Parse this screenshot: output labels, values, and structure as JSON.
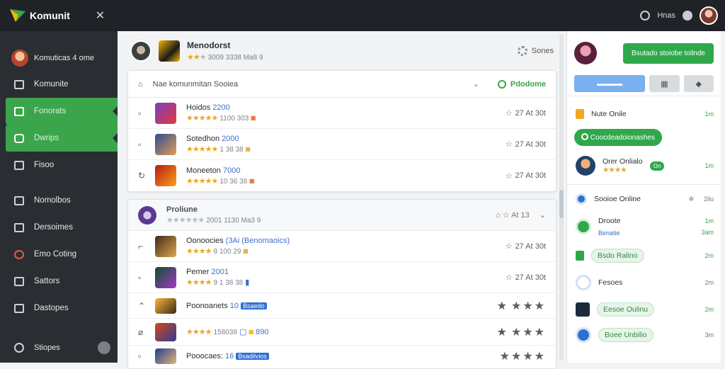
{
  "topbar": {
    "brand": "Komunit",
    "close_icon": "close-icon",
    "right_label": "Hnas"
  },
  "sidebar": {
    "user": "Komuticas 4 ome",
    "items": [
      {
        "label": "Komunite",
        "icon": "panel-icon"
      },
      {
        "label": "Fonorats",
        "icon": "flag-icon",
        "active": true
      },
      {
        "label": "Dwrips",
        "icon": "shield-icon",
        "active": true
      },
      {
        "label": "Fisoo",
        "icon": "grid-icon"
      },
      {
        "label": "Nomolbos",
        "icon": "users-icon"
      },
      {
        "label": "Dersoimes",
        "icon": "list-icon"
      },
      {
        "label": "Emo Coting",
        "icon": "target-icon"
      },
      {
        "label": "Sattors",
        "icon": "sliders-icon"
      },
      {
        "label": "Dastopes",
        "icon": "chat-icon"
      }
    ],
    "footer": "Stiopes"
  },
  "main": {
    "header": {
      "title": "Menodorst",
      "meta": "3009 3338 Ma8 9",
      "right": "Sones"
    },
    "card1": {
      "header": "Nae komunmitan Sooiea",
      "badge": "Pdodome",
      "rows": [
        {
          "name": "Hoidos",
          "num": "2200",
          "meta": "1100 303",
          "right": "27 At 30t"
        },
        {
          "name": "Sotedhon",
          "num": "2000",
          "meta": "1 38 38",
          "right": "27 At 30t"
        },
        {
          "name": "Moneeton",
          "num": "7000",
          "meta": "10 36 38",
          "right": "27 At 30t"
        }
      ]
    },
    "card2": {
      "header": "Proliune",
      "meta": "2001 1130 Ma3 9",
      "header_right": "At 13",
      "rows": [
        {
          "name": "Oonoocies",
          "num": "(3Ai (Benomaoics)",
          "meta": "9 100 29",
          "right": "27 At 30t"
        },
        {
          "name": "Pemer",
          "num": "2001",
          "meta": "9 1 38 38",
          "right": "27 At 30t"
        },
        {
          "name": "Poonoanets",
          "num": "10",
          "tag": "Bsaedo",
          "meta": "",
          "right": "stars"
        },
        {
          "name": "",
          "num": "",
          "meta": "158038",
          "badge": "890",
          "right": "stars"
        },
        {
          "name": "Pooocaes:",
          "num": "16",
          "tag": "Bsadilvios",
          "meta": "",
          "right": "stars"
        }
      ]
    }
  },
  "right_panel": {
    "button": "Bsutado stoiobe toilnde",
    "notifications": [
      {
        "label": "Nute Onile",
        "time": "1m"
      },
      {
        "label": "Coocdeadoionashes",
        "time": ""
      },
      {
        "label": "Orer Onlialo",
        "time": "1m"
      },
      {
        "label": "Sooioe Online",
        "time": "2ilu"
      },
      {
        "label": "Droote",
        "sub": "Benatie",
        "time": "1m",
        "time2": "3am"
      },
      {
        "label": "Bsdo",
        "pill": "Ralino",
        "time": "2m"
      },
      {
        "label": "Fesoes",
        "time": "2m"
      },
      {
        "label": "Eesoe",
        "pill": "Oulinu",
        "time": "2m"
      },
      {
        "label": "Boee",
        "pill": "Unbilio",
        "time": "3m"
      }
    ]
  }
}
